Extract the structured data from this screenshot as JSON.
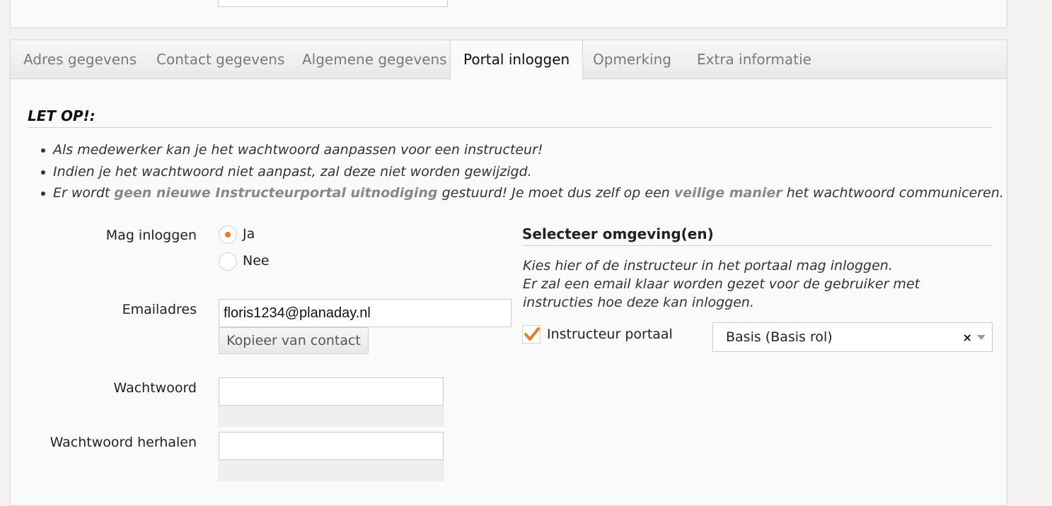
{
  "tabs": [
    {
      "label": "Adres gegevens"
    },
    {
      "label": "Contact gegevens"
    },
    {
      "label": "Algemene gegevens"
    },
    {
      "label": "Portal inloggen",
      "active": true
    },
    {
      "label": "Opmerking"
    },
    {
      "label": "Extra informatie"
    }
  ],
  "notice": {
    "title": "LET OP!:",
    "items": [
      "Als medewerker kan je het wachtwoord aanpassen voor een instructeur!",
      "Indien je het wachtwoord niet aanpast, zal deze niet worden gewijzigd."
    ],
    "item3": {
      "pre": "Er wordt ",
      "hl1": "geen nieuwe Instructeurportal uitnodiging",
      "mid": " gestuurd! Je moet dus zelf op een ",
      "hl2": "veilige manier",
      "post": " het wachtwoord communiceren."
    }
  },
  "form": {
    "login_label": "Mag inloggen",
    "login_options": [
      "Ja",
      "Nee"
    ],
    "login_selected": "Ja",
    "email_label": "Emailadres",
    "email_value": "floris1234@planaday.nl",
    "copy_button": "Kopieer van contact",
    "password_label": "Wachtwoord",
    "password_value": "",
    "password_repeat_label": "Wachtwoord herhalen",
    "password_repeat_value": ""
  },
  "environment": {
    "title": "Selecteer omgeving(en)",
    "desc_line1": "Kies hier of de instructeur in het portaal mag inloggen.",
    "desc_line2": "Er zal een email klaar worden gezet voor de gebruiker met instructies hoe deze kan inloggen.",
    "portal_label": "Instructeur portaal",
    "portal_checked": true,
    "role_value": "Basis (Basis rol)",
    "clear_symbol": "×"
  },
  "colors": {
    "accent": "#f07a1e"
  }
}
